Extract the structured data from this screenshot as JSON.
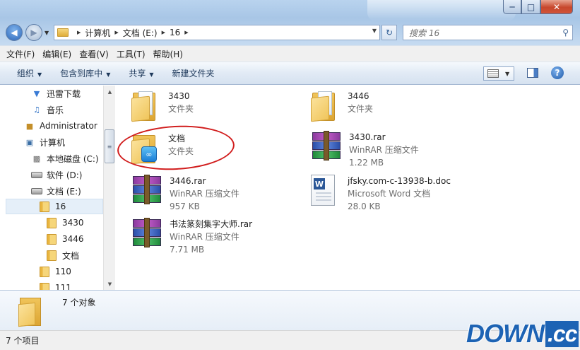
{
  "address": {
    "crumbs": [
      "计算机",
      "文档 (E:)",
      "16"
    ]
  },
  "search": {
    "placeholder": "搜索 16"
  },
  "menu": [
    "文件(F)",
    "编辑(E)",
    "查看(V)",
    "工具(T)",
    "帮助(H)"
  ],
  "commands": [
    "组织",
    "包含到库中",
    "共享",
    "新建文件夹"
  ],
  "nav_pane": {
    "items": [
      {
        "label": "迅雷下载",
        "icon": "download-icon"
      },
      {
        "label": "音乐",
        "icon": "music-icon"
      },
      {
        "label": "Administrator",
        "icon": "user-icon"
      },
      {
        "label": "计算机",
        "icon": "computer-icon"
      },
      {
        "label": "本地磁盘 (C:)",
        "icon": "drive-icon"
      },
      {
        "label": "软件 (D:)",
        "icon": "drive-icon"
      },
      {
        "label": "文档 (E:)",
        "icon": "drive-icon"
      },
      {
        "label": "16",
        "icon": "folder-icon"
      },
      {
        "label": "3430",
        "icon": "folder-icon"
      },
      {
        "label": "3446",
        "icon": "folder-icon"
      },
      {
        "label": "文档",
        "icon": "folder-icon"
      },
      {
        "label": "110",
        "icon": "folder-icon"
      },
      {
        "label": "111",
        "icon": "folder-icon"
      }
    ]
  },
  "files": [
    {
      "name": "3430",
      "type": "文件夹",
      "size": ""
    },
    {
      "name": "3446",
      "type": "文件夹",
      "size": ""
    },
    {
      "name": "文档",
      "type": "文件夹",
      "size": ""
    },
    {
      "name": "3430.rar",
      "type": "WinRAR 压缩文件",
      "size": "1.22 MB"
    },
    {
      "name": "3446.rar",
      "type": "WinRAR 压缩文件",
      "size": "957 KB"
    },
    {
      "name": "jfsky.com-c-13938-b.doc",
      "type": "Microsoft Word 文档",
      "size": "28.0 KB"
    },
    {
      "name": "书法篆刻集字大师.rar",
      "type": "WinRAR 压缩文件",
      "size": "7.71 MB"
    }
  ],
  "details": {
    "count": "7 个对象"
  },
  "status": {
    "text": "7 个项目"
  },
  "watermark": {
    "main": "DOWN",
    "suffix": ".cc"
  },
  "colors": {
    "annotation_circle": "#d11d1d",
    "accent": "#1d63b4"
  }
}
